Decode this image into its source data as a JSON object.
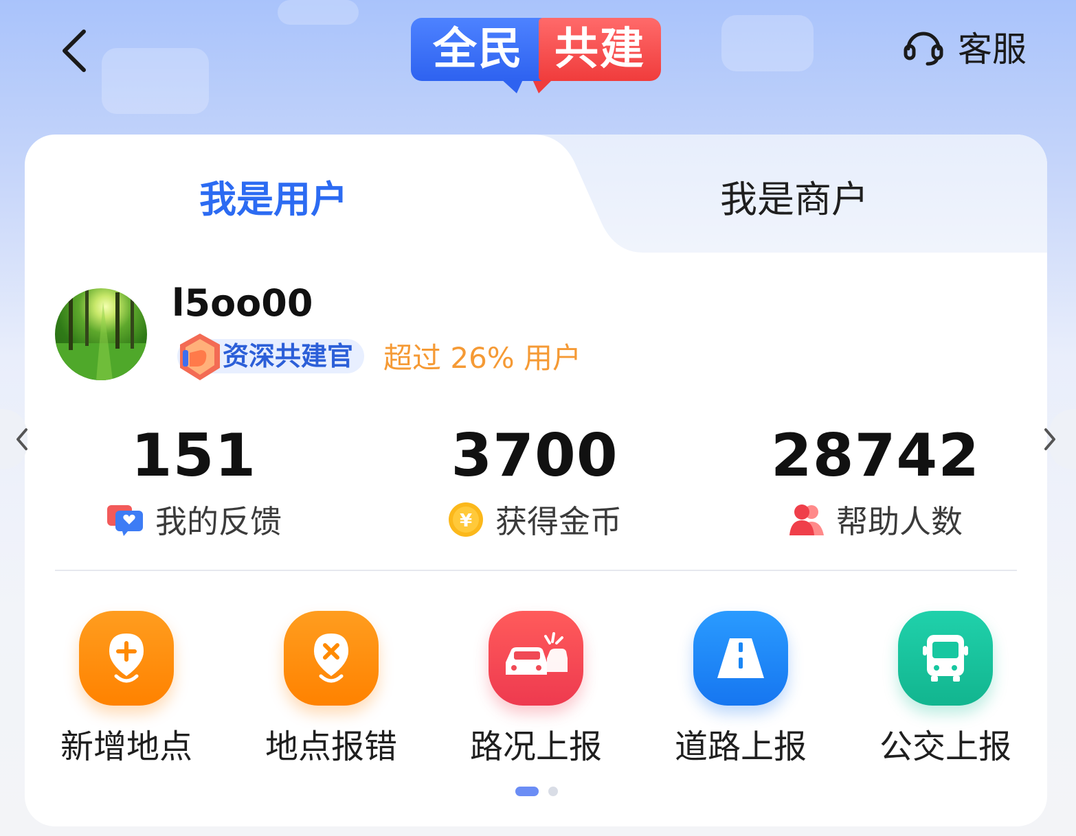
{
  "header": {
    "back_icon": "chevron-left-icon",
    "logo_left": "全民",
    "logo_right": "共建",
    "customer_service_label": "客服",
    "customer_service_icon": "headset-icon"
  },
  "tabs": [
    {
      "label": "我是用户",
      "active": true
    },
    {
      "label": "我是商户",
      "active": false
    }
  ],
  "profile": {
    "username": "l5oo00",
    "badge_label": "资深共建官",
    "rank_text": "超过 26% 用户"
  },
  "stats": [
    {
      "value": "151",
      "label": "我的反馈",
      "icon": "feedback-icon"
    },
    {
      "value": "3700",
      "label": "获得金币",
      "icon": "coin-icon"
    },
    {
      "value": "28742",
      "label": "帮助人数",
      "icon": "people-icon"
    }
  ],
  "actions": [
    {
      "label": "新增地点",
      "icon": "add-location-icon",
      "color": "#ff8a00"
    },
    {
      "label": "地点报错",
      "icon": "location-error-icon",
      "color": "#ff8a00"
    },
    {
      "label": "路况上报",
      "icon": "traffic-accident-icon",
      "color": "#f2434f"
    },
    {
      "label": "道路上报",
      "icon": "road-icon",
      "color": "#1a8cff"
    },
    {
      "label": "公交上报",
      "icon": "bus-icon",
      "color": "#17c7a0"
    }
  ],
  "pager": {
    "pages": 2,
    "current": 1
  },
  "colors": {
    "primary_blue": "#2c6bf2",
    "rank_orange": "#f59a35"
  }
}
